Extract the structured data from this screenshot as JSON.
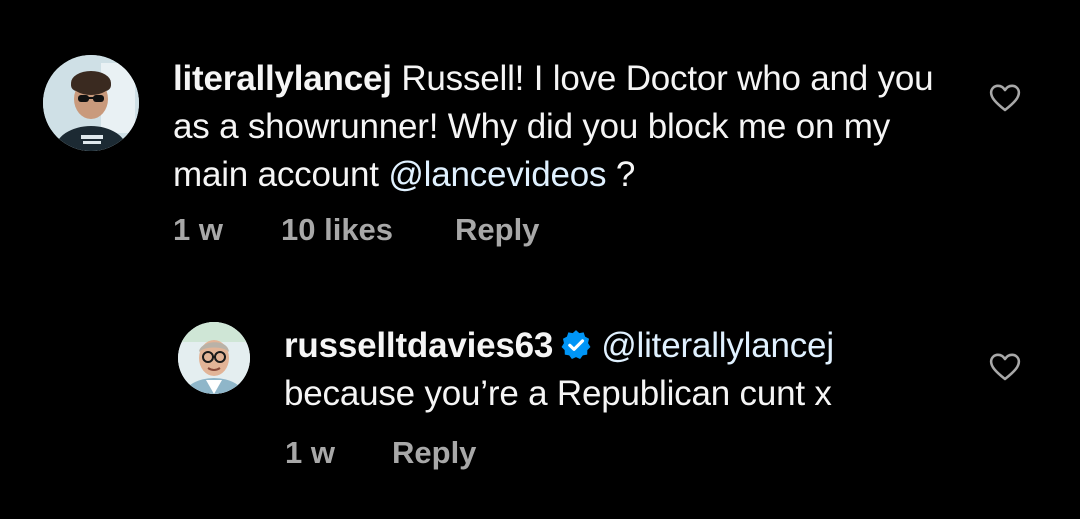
{
  "comments": [
    {
      "username": "literallylancej",
      "text": "Russell! I love Doctor who and you as a showrunner! Why did you block me on my main account",
      "mention": "@lancevideos",
      "text_after": "?",
      "time": "1 w",
      "likes": "10 likes",
      "reply_label": "Reply",
      "liked": false,
      "verified": false
    },
    {
      "username": "russelltdavies63",
      "mention": "@literallylancej",
      "text": "because you’re a Republican cunt x",
      "time": "1 w",
      "reply_label": "Reply",
      "liked": false,
      "verified": true
    }
  ],
  "colors": {
    "background": "#000000",
    "text": "#f5f5f5",
    "meta": "#a8a8a8",
    "mention": "#e0f1ff",
    "verified_badge": "#0095f6"
  },
  "icons": {
    "like": "heart-outline-icon",
    "verified": "verified-badge-icon"
  }
}
